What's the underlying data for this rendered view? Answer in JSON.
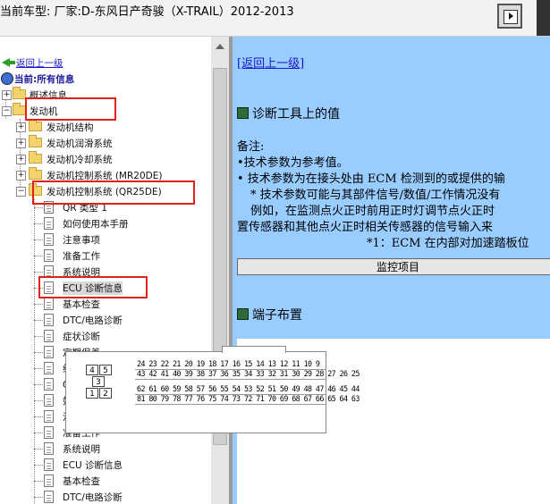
{
  "title_bar": {
    "title": "当前车型:  厂家:D-东风日产奇骏（X-TRAIL）2012-2013"
  },
  "tree": {
    "back_label": "返回上一级",
    "current_label": "当前:所有信息",
    "nodes": {
      "overview": "概述信息",
      "engine": "发动机",
      "engine_structure": "发动机结构",
      "lubrication": "发动机润滑系统",
      "cooling": "发动机冷却系统",
      "control_mr20": "发动机控制系统 (MR20DE)",
      "control_qr25": "发动机控制系统 (QR25DE)",
      "items": [
        "QR 类型 1",
        "如何使用本手册",
        "注意事项",
        "准备工作",
        "系统说明",
        "ECU 诊断信息",
        "基本检查",
        "DTC/电路诊断",
        "症状诊断",
        "定期保养",
        "维修数据和规格 (SDS)",
        "QR 类型 2",
        "如何使用本手册",
        "注意事项",
        "准备工作",
        "系统说明",
        "ECU 诊断信息",
        "基本检查",
        "DTC/电路诊断"
      ]
    }
  },
  "content": {
    "back_link": "[返回上一级]",
    "section1_title": "诊断工具上的值",
    "note_label": "备注:",
    "bullet1": "•技术参数为参考值。",
    "bullet2": "• 技术参数为在接头处由 ECM 检测到的或提供的输",
    "line3": "* 技术参数可能与其部件信号/数值/工作情况没有",
    "line4": "例如，在监测点火正时前用正时灯调节点火正时",
    "line5": "置传感器和其他点火正时相关传感器的信号输入来",
    "line6": "*1：ECM 在内部对加速踏板位",
    "monitor_header": "监控项目",
    "section2_title": "端子布置",
    "connector": {
      "small_pins": [
        "4",
        "5",
        "3",
        "1",
        "2"
      ],
      "row1": "24 23 22 21 20 19 18 17 16 15 14 13 12 11 10 9",
      "row2": "43 42 41 40 39 38 37 36 35 34 33 32 31 30 29 28 27 26 25",
      "row3": "62 61 60 59 58 57 56 55 54 53 52 51 50 49 48 47 46 45 44",
      "row4": "81 80 79 78 77 76 75 74 73 72 71 70 69 68 67 66 65 64 63"
    }
  }
}
